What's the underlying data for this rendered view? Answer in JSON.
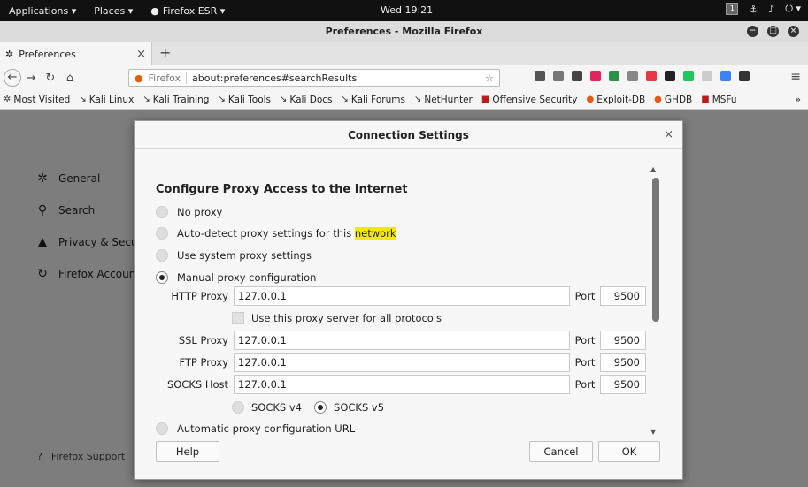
{
  "topbar": {
    "applications": "Applications ▾",
    "places": "Places ▾",
    "app_name": "Firefox ESR ▾",
    "clock": "Wed 19:21",
    "tray_badge": "1"
  },
  "window": {
    "title": "Preferences - Mozilla Firefox"
  },
  "tab": {
    "title": "Preferences",
    "close": "×",
    "new_tab": "+"
  },
  "navbar": {
    "identity": "Firefox",
    "url": "about:preferences#searchResults"
  },
  "bookmarks": [
    {
      "label": "Most Visited",
      "icon": "gear-icon"
    },
    {
      "label": "Kali Linux",
      "icon": "kali-icon"
    },
    {
      "label": "Kali Training",
      "icon": "kali-icon"
    },
    {
      "label": "Kali Tools",
      "icon": "kali-icon"
    },
    {
      "label": "Kali Docs",
      "icon": "kali-icon"
    },
    {
      "label": "Kali Forums",
      "icon": "kali-icon"
    },
    {
      "label": "NetHunter",
      "icon": "kali-icon"
    },
    {
      "label": "Offensive Security",
      "icon": "offsec-icon"
    },
    {
      "label": "Exploit-DB",
      "icon": "exploitdb-icon"
    },
    {
      "label": "GHDB",
      "icon": "ghdb-icon"
    },
    {
      "label": "MSFu",
      "icon": "msfu-icon"
    }
  ],
  "sidebar": {
    "items": [
      {
        "label": "General",
        "icon": "gear-icon"
      },
      {
        "label": "Search",
        "icon": "search-icon"
      },
      {
        "label": "Privacy & Secur",
        "icon": "lock-icon"
      },
      {
        "label": "Firefox Account",
        "icon": "sync-icon"
      }
    ],
    "support": "Firefox Support"
  },
  "dialog": {
    "title": "Connection Settings",
    "close": "×",
    "section_title": "Configure Proxy Access to the Internet",
    "options": {
      "no_proxy": "No proxy",
      "auto_detect_pre": "Auto-detect proxy settings for this ",
      "auto_detect_hl": "network",
      "system": "Use system proxy settings",
      "manual": "Manual proxy configuration",
      "auto_url": "Automatic proxy configuration URL"
    },
    "selected_option": "manual",
    "http": {
      "label": "HTTP Proxy",
      "host": "127.0.0.1",
      "port_label": "Port",
      "port": "9500"
    },
    "use_all": {
      "label": "Use this proxy server for all protocols",
      "checked": false
    },
    "ssl": {
      "label": "SSL Proxy",
      "host": "127.0.0.1",
      "port_label": "Port",
      "port": "9500"
    },
    "ftp": {
      "label": "FTP Proxy",
      "host": "127.0.0.1",
      "port_label": "Port",
      "port": "9500"
    },
    "socks": {
      "label": "SOCKS Host",
      "host": "127.0.0.1",
      "port_label": "Port",
      "port": "9500"
    },
    "socks_version": {
      "v4": "SOCKS v4",
      "v5": "SOCKS v5",
      "selected": "v5"
    },
    "buttons": {
      "help": "Help",
      "cancel": "Cancel",
      "ok": "OK"
    }
  },
  "colors": {
    "highlight": "#f4e80b",
    "content_dim": "#7d7d7d",
    "topbar": "#111111"
  }
}
